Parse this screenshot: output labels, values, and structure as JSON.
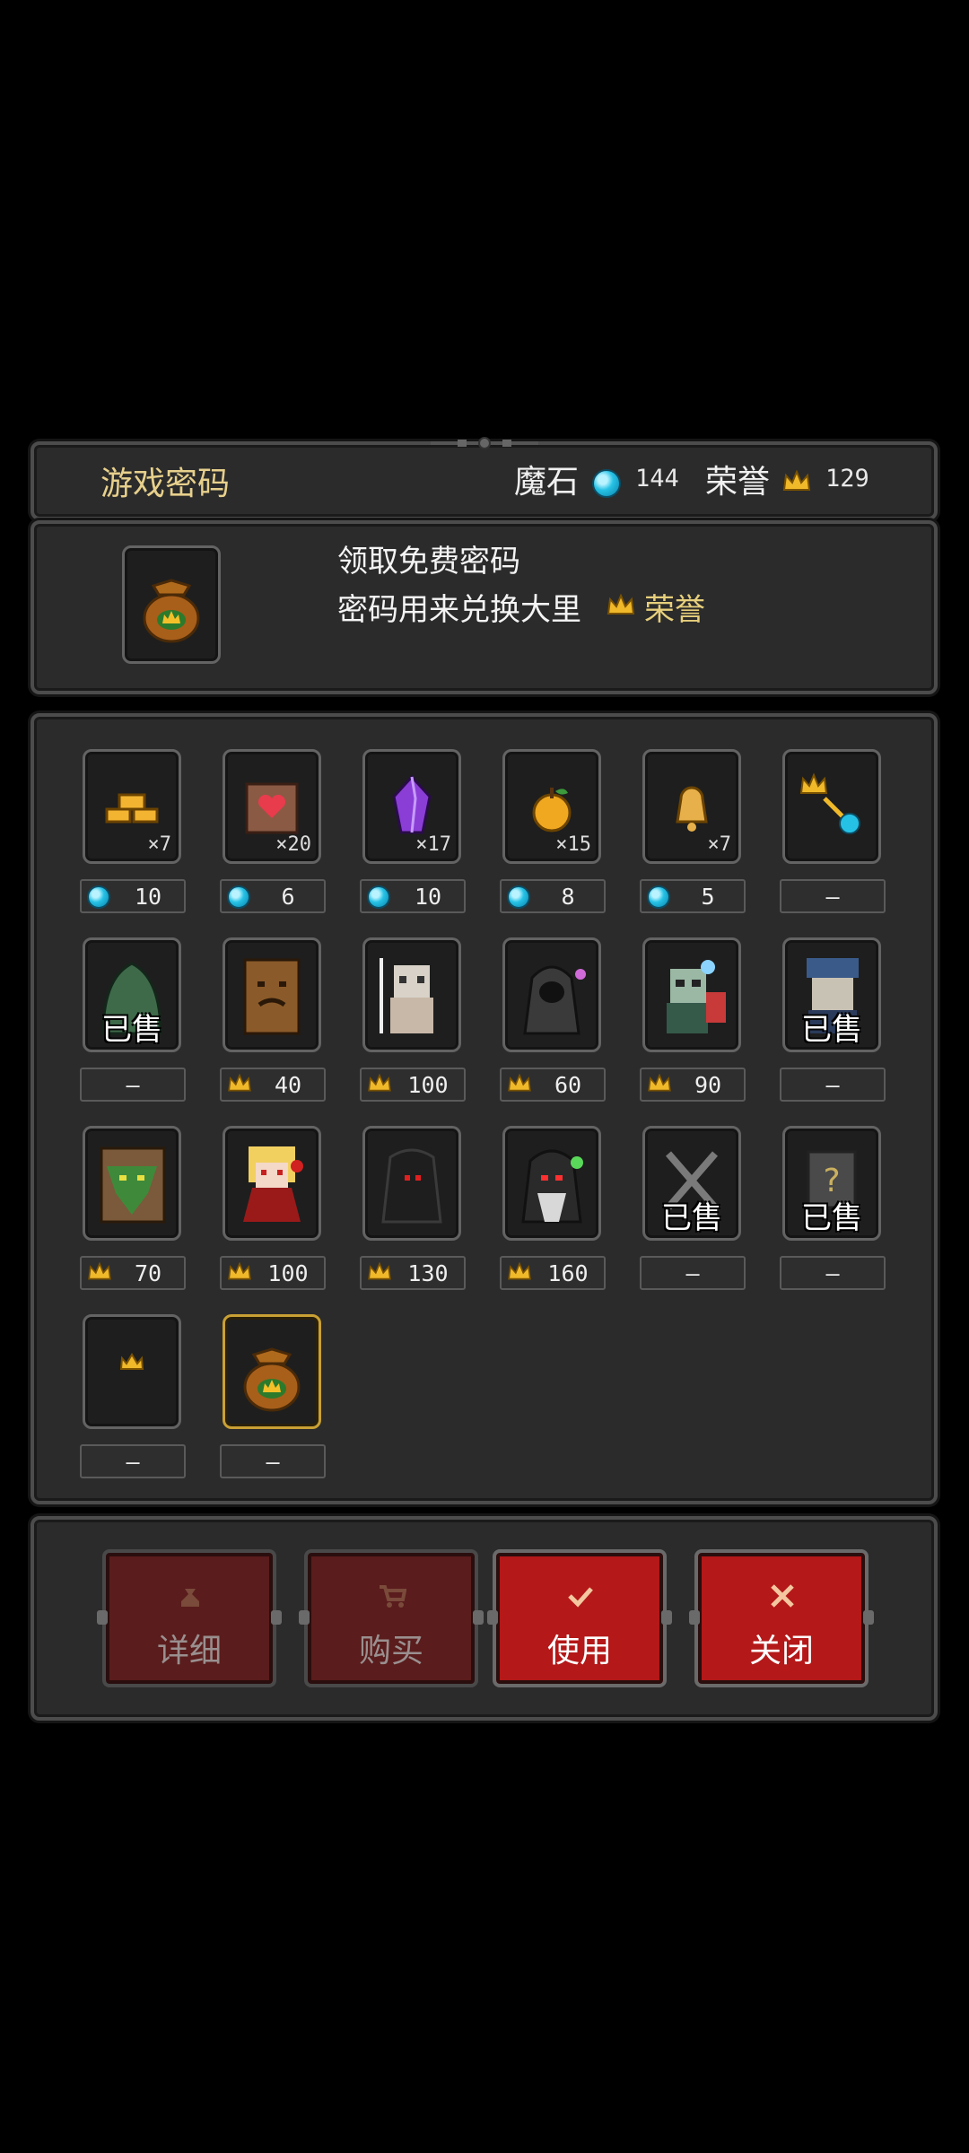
{
  "header": {
    "title": "游戏密码",
    "magic_stone_label": "魔石",
    "magic_stone_value": "144",
    "honor_label": "荣誉",
    "honor_value": "129"
  },
  "info": {
    "line1": "领取免费密码",
    "line2_prefix": "密码用来兑换大里",
    "line2_suffix": "荣誉"
  },
  "items": [
    {
      "icon": "gold-ingots-icon",
      "qty": "×7",
      "currency": "gem",
      "price": "10"
    },
    {
      "icon": "heart-scroll-icon",
      "qty": "×20",
      "currency": "gem",
      "price": "6"
    },
    {
      "icon": "purple-crystal-icon",
      "qty": "×17",
      "currency": "gem",
      "price": "10"
    },
    {
      "icon": "golden-apple-icon",
      "qty": "×15",
      "currency": "gem",
      "price": "8"
    },
    {
      "icon": "bell-icon",
      "qty": "×7",
      "currency": "gem",
      "price": "5"
    },
    {
      "icon": "crown-to-gem-icon",
      "qty": "",
      "currency": "none",
      "price": "—"
    },
    {
      "icon": "green-slime-icon",
      "sold": "已售",
      "currency": "none",
      "price": "–"
    },
    {
      "icon": "treant-icon",
      "currency": "crown",
      "price": "40"
    },
    {
      "icon": "skeleton-knight-icon",
      "currency": "crown",
      "price": "100"
    },
    {
      "icon": "hooded-mage-icon",
      "currency": "crown",
      "price": "60"
    },
    {
      "icon": "zombie-soldier-icon",
      "currency": "crown",
      "price": "90"
    },
    {
      "icon": "blue-pirate-icon",
      "sold": "已售",
      "currency": "none",
      "price": "–"
    },
    {
      "icon": "forest-guardian-icon",
      "currency": "crown",
      "price": "70"
    },
    {
      "icon": "vampire-girl-icon",
      "currency": "crown",
      "price": "100"
    },
    {
      "icon": "shadow-reaper-icon",
      "currency": "crown",
      "price": "130"
    },
    {
      "icon": "dark-wizard-icon",
      "currency": "crown",
      "price": "160"
    },
    {
      "icon": "crossed-swords-icon",
      "sold": "已售",
      "currency": "none",
      "price": "–"
    },
    {
      "icon": "mystery-box-icon",
      "sold": "已售",
      "currency": "none",
      "price": "–"
    },
    {
      "icon": "crown-icon",
      "currency": "none",
      "price": "—"
    },
    {
      "icon": "gold-bag-icon",
      "currency": "none",
      "price": "—",
      "selected": true
    }
  ],
  "buttons": {
    "detail": "详细",
    "buy": "购买",
    "use": "使用",
    "close": "关闭"
  },
  "colors": {
    "gold": "#e7cf7c",
    "gem": "#26c2e6",
    "button_red": "#b41818"
  }
}
